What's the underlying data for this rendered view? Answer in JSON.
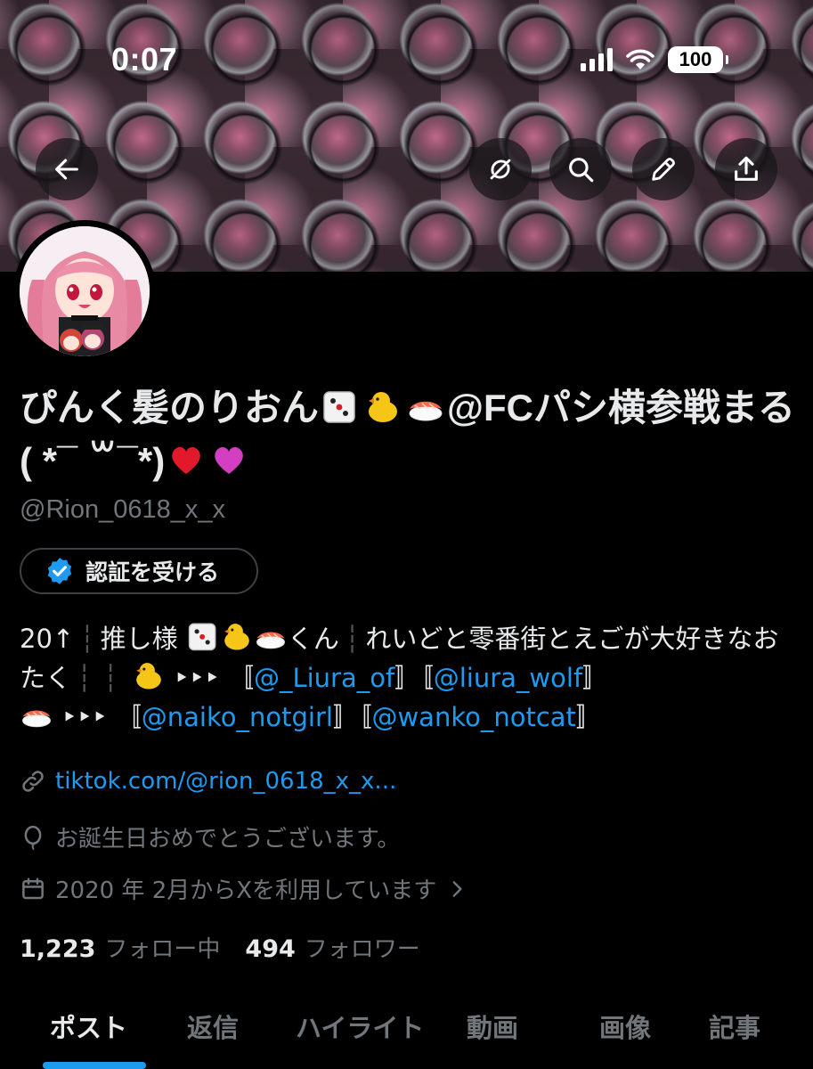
{
  "status_bar": {
    "time": "0:07",
    "battery": "100"
  },
  "banner_buttons": [
    "back-icon",
    "hide-retweets-icon",
    "search-icon",
    "edit-icon",
    "share-icon"
  ],
  "profile": {
    "display_name_part1": "ぴんく髪のりおん",
    "display_name_part2": "@FCパシ横参戦まる ( *¯ ꒳¯*)",
    "handle": "@Rion_0618_x_x",
    "verify_label": "認証を受ける"
  },
  "bio": {
    "line1_a": "20↑",
    "line1_b": "推し様",
    "line1_c": "くん",
    "line1_d": "れいどと零番街とえごが大好きなおたく",
    "arrow": "‣‣‣",
    "lb": "〚",
    "rb": "〛",
    "mention1": "@_Liura_of",
    "mention2": "@liura_wolf",
    "mention3": "@naiko_notgirl",
    "mention4": "@wanko_notcat"
  },
  "meta": {
    "link": "tiktok.com/@rion_0618_x_x...",
    "birthday": "お誕生日おめでとうございます。",
    "joined": "2020 年 2月からXを利用しています"
  },
  "follow": {
    "following_count": "1,223",
    "following_label": "フォロー中",
    "followers_count": "494",
    "followers_label": "フォロワー"
  },
  "tabs": [
    "ポスト",
    "返信",
    "ハイライト",
    "動画",
    "画像",
    "記事"
  ],
  "colors": {
    "accent": "#1d9bf0",
    "background": "#000000",
    "muted": "#71767b",
    "text": "#e7e9ea"
  }
}
